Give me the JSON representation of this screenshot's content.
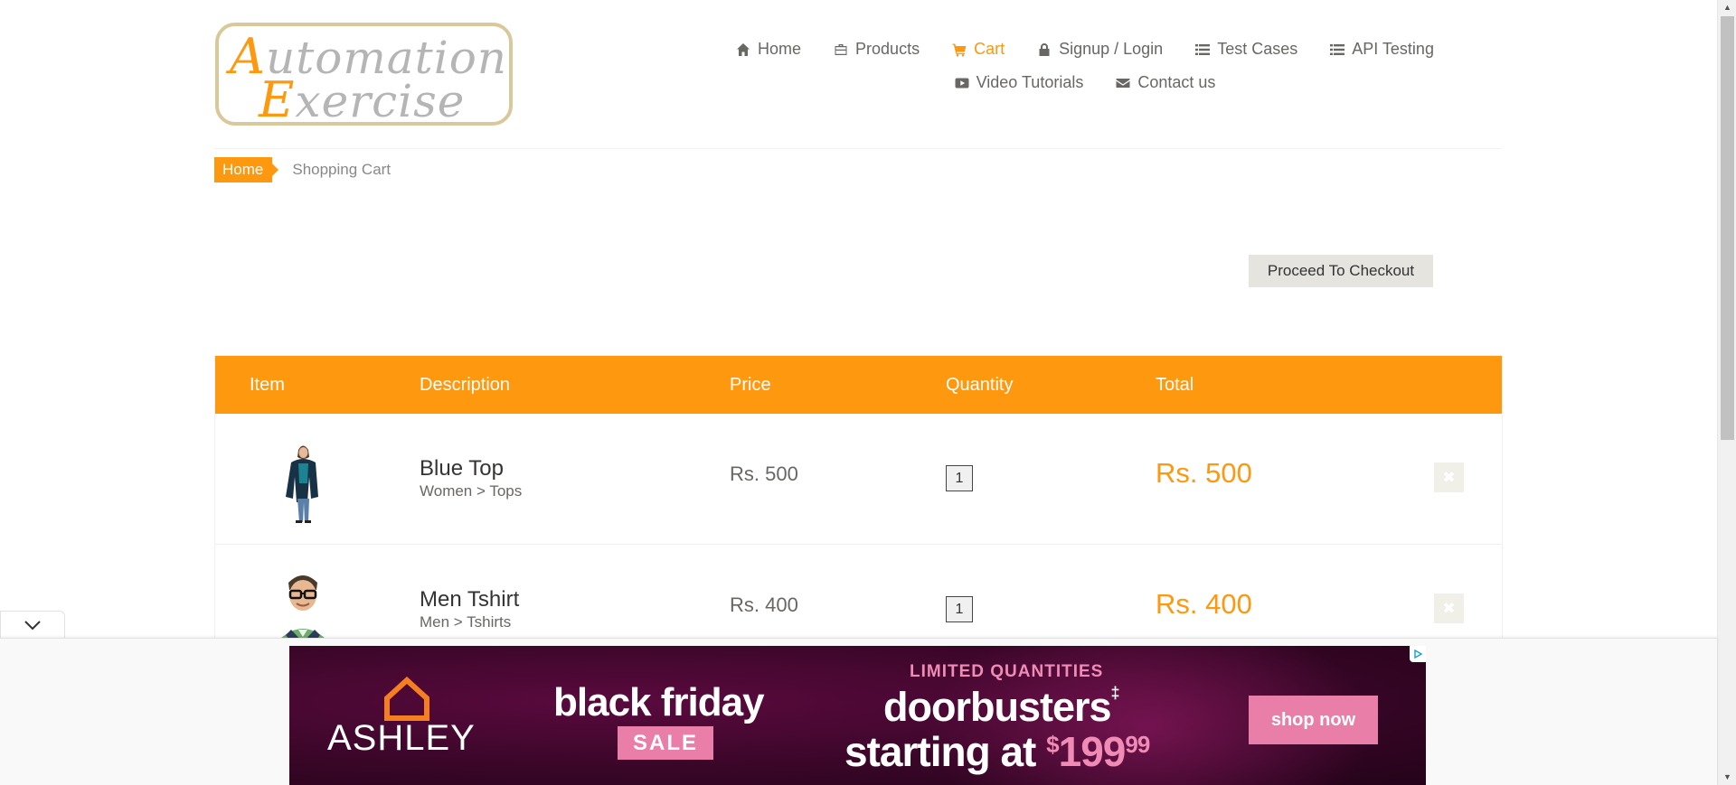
{
  "logo": {
    "line1_cap": "A",
    "line1_rest": "utomation",
    "line2_cap": "E",
    "line2_rest": "xercise"
  },
  "nav": {
    "row1": [
      {
        "label": "Home",
        "icon": "home-icon"
      },
      {
        "label": "Products",
        "icon": "briefcase-icon"
      },
      {
        "label": "Cart",
        "icon": "cart-icon",
        "active": true
      },
      {
        "label": "Signup / Login",
        "icon": "lock-icon"
      },
      {
        "label": "Test Cases",
        "icon": "list-icon"
      },
      {
        "label": "API Testing",
        "icon": "list-icon"
      }
    ],
    "row2": [
      {
        "label": "Video Tutorials",
        "icon": "youtube-play-icon"
      },
      {
        "label": "Contact us",
        "icon": "envelope-icon"
      }
    ]
  },
  "breadcrumb": {
    "home": "Home",
    "current": "Shopping Cart"
  },
  "checkout": {
    "label": "Proceed To Checkout"
  },
  "cart": {
    "headers": {
      "item": "Item",
      "description": "Description",
      "price": "Price",
      "quantity": "Quantity",
      "total": "Total"
    },
    "rows": [
      {
        "name": "Blue Top",
        "category": "Women > Tops",
        "price": "Rs. 500",
        "quantity": "1",
        "total": "Rs. 500"
      },
      {
        "name": "Men Tshirt",
        "category": "Men > Tshirts",
        "price": "Rs. 400",
        "quantity": "1",
        "total": "Rs. 400"
      }
    ],
    "delete_icon": "times-icon"
  },
  "ad": {
    "brand": "ASHLEY",
    "headline": "black friday",
    "badge": "SALE",
    "kicker": "LIMITED QUANTITIES",
    "line1": "doorbusters",
    "line1_mark": "‡",
    "line2_prefix": "starting at ",
    "price_currency": "$",
    "price_main": "199",
    "price_cents": "99",
    "cta": "shop now"
  },
  "colors": {
    "accent": "#fe980f",
    "text": "#696763",
    "ad_pink": "#e97fa9"
  }
}
